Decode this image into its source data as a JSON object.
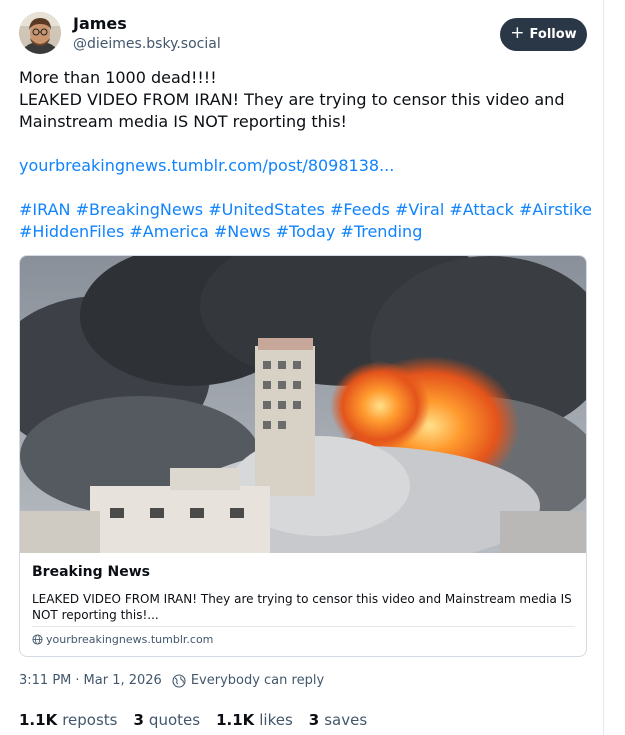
{
  "author": {
    "display_name": "James",
    "handle": "@dieimes.bsky.social"
  },
  "follow_button": {
    "label": "Follow"
  },
  "post_text": {
    "line1": "More than 1000 dead!!!!",
    "line2": "LEAKED VIDEO FROM IRAN! They are trying to censor this video and",
    "line3": "Mainstream media IS NOT reporting this!",
    "link": "yourbreakingnews.tumblr.com/post/8098138...",
    "hashtags_line1": [
      "#IRAN",
      "#BreakingNews",
      "#UnitedStates",
      "#Feeds",
      "#Viral",
      "#Attack",
      "#Airstike"
    ],
    "hashtags_line2": [
      "#HiddenFiles",
      "#America",
      "#News",
      "#Today",
      "#Trending"
    ]
  },
  "link_card": {
    "title": "Breaking News",
    "description": "LEAKED VIDEO FROM IRAN! They are trying to censor this video and Mainstream media IS NOT reporting this!...",
    "domain": "yourbreakingnews.tumblr.com"
  },
  "meta": {
    "time": "3:11 PM",
    "separator": "·",
    "date": "Mar 1, 2026",
    "reply_setting": "Everybody can reply"
  },
  "stats": {
    "reposts_count": "1.1K",
    "reposts_label": "reposts",
    "quotes_count": "3",
    "quotes_label": "quotes",
    "likes_count": "1.1K",
    "likes_label": "likes",
    "saves_count": "3",
    "saves_label": "saves"
  },
  "colors": {
    "link": "#1083fe",
    "follow_bg": "#2a3746",
    "muted_text": "#42576c"
  }
}
